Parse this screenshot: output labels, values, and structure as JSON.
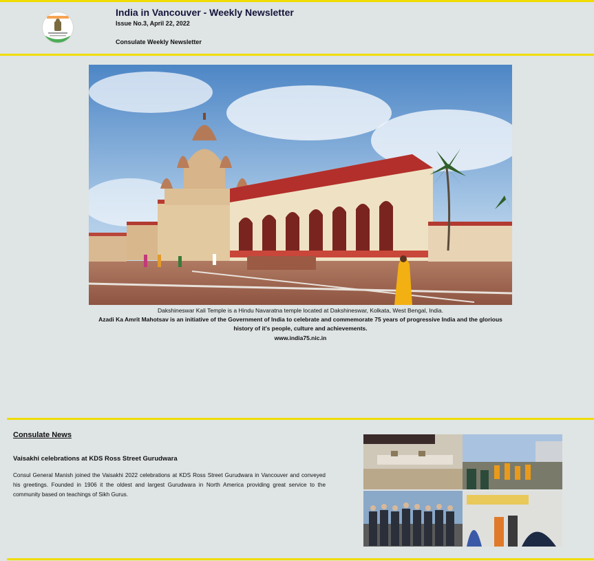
{
  "header": {
    "title": "India in Vancouver - Weekly Newsletter",
    "issue": "Issue No.3, April 22, 2022",
    "subtitle": "Consulate Weekly Newsletter",
    "logo_icon": "consulate-emblem-icon"
  },
  "hero": {
    "image_icon": "temple-photo",
    "caption": "Dakshineswar Kali Temple is a Hindu Navaratna temple located at Dakshineswar, Kolkata, West Bengal, India.",
    "initiative": "Azadi Ka Amrit Mahotsav is an initiative of the Government of India to celebrate and commemorate 75 years of progressive India and the glorious history of it's people, culture and achievements.",
    "link": "www.india75.nic.in"
  },
  "news": {
    "heading": "Consulate News",
    "item_title": "Vaisakhi celebrations at KDS Ross Street Gurudwara",
    "item_body": "Consul General Manish joined the Vaisakhi 2022 celebrations at KDS Ross Street Gurudwara in Vancouver and conveyed his greetings. Founded in 1906 it the oldest and largest Gurudwara in North America providing great service to the community based on teachings of Sikh Gurus.",
    "collage_icon": "event-photo-collage"
  },
  "colors": {
    "background": "#dfe4e4",
    "rule": "#f0dc00",
    "title": "#14143c"
  }
}
